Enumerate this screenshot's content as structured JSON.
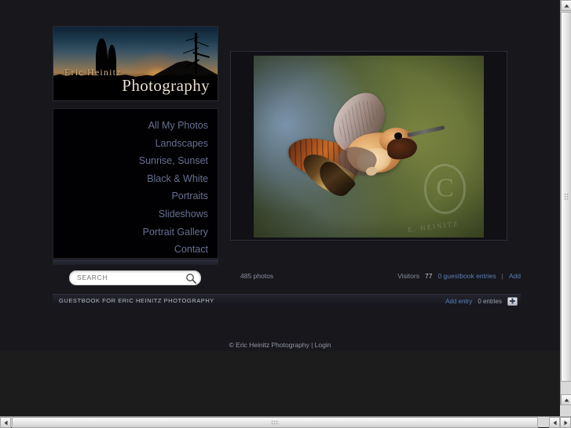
{
  "site": {
    "header": {
      "name": "Eric  Heinitz",
      "title": "Photography"
    },
    "nav": {
      "items": [
        {
          "label": "All My Photos"
        },
        {
          "label": "Landscapes"
        },
        {
          "label": "Sunrise, Sunset"
        },
        {
          "label": "Black & White"
        },
        {
          "label": "Portraits"
        },
        {
          "label": "Slideshows"
        },
        {
          "label": "Portrait Gallery"
        },
        {
          "label": "Contact"
        }
      ]
    },
    "search": {
      "value": "",
      "placeholder": "SEARCH",
      "icon": "search-icon"
    },
    "featured_photo": {
      "subject": "hummingbird",
      "watermark_letter": "C",
      "watermark_text": "E. HEINITZ"
    },
    "info": {
      "photo_count": "485 photos",
      "visitors_label": "Visitors",
      "visitors_count": "77",
      "guestbook_entries_link": "0 guestbook entries",
      "separator": "|",
      "add_link": "Add"
    },
    "guestbook": {
      "title": "GUESTBOOK FOR ERIC HEINITZ PHOTOGRAPHY",
      "add_entry_link": "Add entry",
      "entries_count": "0 entries",
      "add_icon": "plus-icon"
    },
    "footer": {
      "copyright": "© Eric Heinitz Photography |",
      "login_link": "Login"
    }
  },
  "browser": {
    "vertical_scrollbar": {
      "up_icon": "triangle-up-icon",
      "down_icon": "triangle-down-icon",
      "down_icon_2": "triangle-down-icon"
    },
    "horizontal_scrollbar": {
      "left_icon": "triangle-left-icon",
      "right_icon_1": "triangle-left-icon",
      "right_icon_2": "triangle-right-icon"
    }
  },
  "colors": {
    "page_bg": "#17171c",
    "nav_link": "#697091",
    "accent_link": "#5b7fb5",
    "header_name": "#d8b382",
    "header_title": "#e9dfcf"
  }
}
